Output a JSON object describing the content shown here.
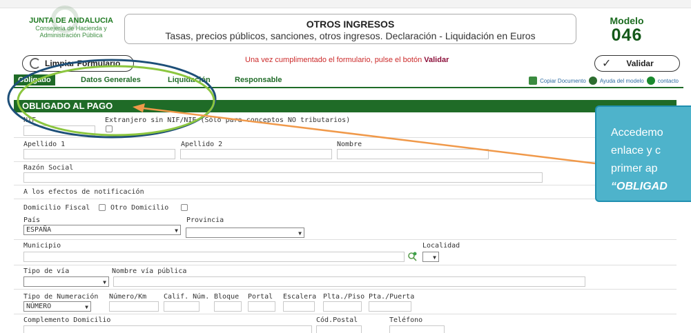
{
  "header": {
    "org_line1": "JUNTA DE ANDALUCIA",
    "org_line2": "Consejería de Hacienda y",
    "org_line3": "Administración Pública",
    "title": "OTROS INGRESOS",
    "subtitle": "Tasas, precios públicos, sanciones, otros ingresos. Declaración - Liquidación en Euros",
    "modelo_label": "Modelo",
    "modelo_number": "046"
  },
  "actions": {
    "clear_label": "Limpiar Formulario",
    "validate_label": "Validar",
    "notice_text": "Una vez cumplimentado el formulario, pulse el botón",
    "notice_emph": "Validar"
  },
  "tabs": [
    "Obligado",
    "Datos Generales",
    "Liquidación",
    "Responsable"
  ],
  "tools": {
    "copy": "Copiar Documento",
    "help": "Ayuda del modelo",
    "contact": "contacto"
  },
  "section": {
    "title": "OBLIGADO AL PAGO"
  },
  "form": {
    "nif": "NIF",
    "extranjero": "Extranjero sin NIF/NIE (Sólo para conceptos NO tributarios)",
    "apellido1": "Apellido 1",
    "apellido2": "Apellido 2",
    "nombre": "Nombre",
    "razon_social": "Razón Social",
    "notificacion": "A los efectos de notificación",
    "domicilio_fiscal": "Domicilio Fiscal",
    "otro_domicilio": "Otro Domicilio",
    "pais": "País",
    "pais_value": "ESPAÑA",
    "provincia": "Provincia",
    "municipio": "Municipio",
    "localidad": "Localidad",
    "tipo_via": "Tipo de vía",
    "nombre_via": "Nombre vía pública",
    "tipo_numeracion": "Tipo de Numeración",
    "tipo_numeracion_value": "NÚMERO",
    "numero_km": "Número/Km",
    "calif_num": "Calif. Núm.",
    "bloque": "Bloque",
    "portal": "Portal",
    "escalera": "Escalera",
    "plta_piso": "Plta./Piso",
    "pta_puerta": "Pta./Puerta",
    "complemento": "Complemento Domicilio",
    "cod_postal": "Cód.Postal",
    "telefono": "Teléfono"
  },
  "callout": {
    "line1": "Accedemo",
    "line2": "enlace y c",
    "line3": "primer ap",
    "line4": "“OBLIGAD"
  },
  "colors": {
    "green": "#1f6b27",
    "callout": "#4eb3cb",
    "arrow": "#f0994a",
    "highlight": "#8cc63f"
  }
}
